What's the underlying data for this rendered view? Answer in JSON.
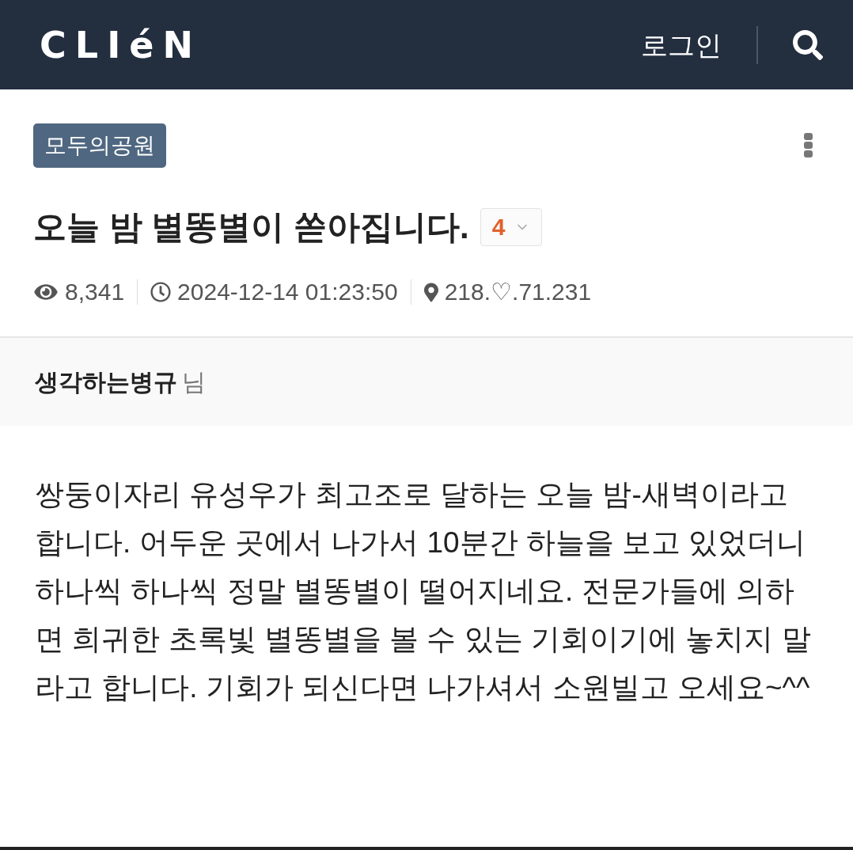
{
  "header": {
    "logo": "CLIéN",
    "login": "로그인"
  },
  "post": {
    "board": "모두의공원",
    "title": "오늘 밤 별똥별이 쏟아집니다.",
    "comment_count": "4",
    "meta": [
      {
        "kind": "views",
        "text": "8,341"
      },
      {
        "kind": "date",
        "text": "2024-12-14 01:23:50"
      },
      {
        "kind": "ip",
        "text": "218.♡.71.231"
      }
    ],
    "author": {
      "name": "생각하는병규",
      "suffix": "님"
    },
    "body": "쌍둥이자리 유성우가 최고조로 달하는 오늘 밤-새벽이라고 합니다. 어두운 곳에서 나가서 10분간 하늘을 보고 있었더니 하나씩 하나씩 정말 별똥별이 떨어지네요. 전문가들에 의하면 희귀한 초록빛 별똥별을 볼 수 있는 기회이기에 놓치지 말라고 합니다. 기회가 되신다면 나가셔서 소원빌고 오세요~^^"
  }
}
